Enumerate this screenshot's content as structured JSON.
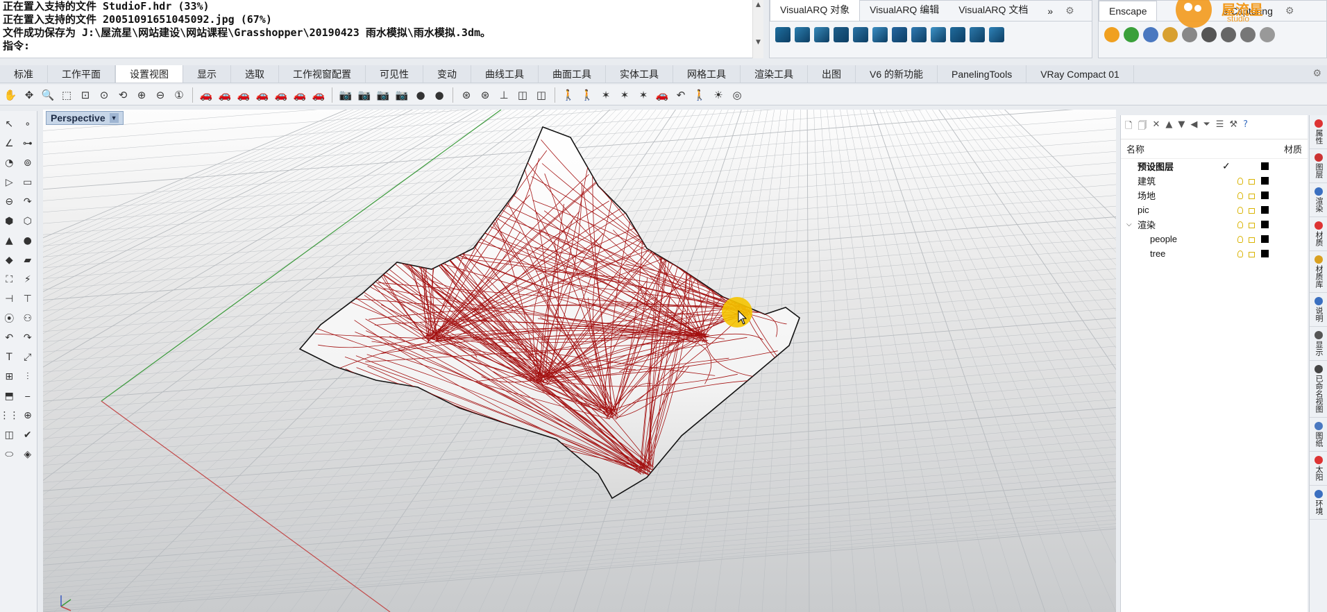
{
  "command_history": {
    "lines": [
      "正在置入支持的文件 StudioF.hdr (33%)",
      "正在置入支持的文件 20051091651045092.jpg (67%)",
      "文件成功保存为 J:\\屋流星\\网站建设\\网站课程\\Grasshopper\\20190423 雨水模拟\\雨水模拟.3dm。"
    ],
    "prompt_label": "指令:",
    "prompt_value": ""
  },
  "visualarq_panel": {
    "tabs": [
      "VisualARQ 对象",
      "VisualARQ 编辑",
      "VisualARQ 文档"
    ],
    "more": "»",
    "icon_colors": [
      "#1e6fa0",
      "#2c7fb0",
      "#3789b9",
      "#1f5f8b",
      "#2a73a6",
      "#3a8ec4",
      "#2566a0",
      "#2f7ab3",
      "#3d93c8",
      "#206b9d",
      "#2b78aa",
      "#2e82b8"
    ]
  },
  "enscape_panel": {
    "tabs": [
      "Enscape",
      "e Capturing"
    ],
    "icon_colors": [
      "#f0a020",
      "#3aa03a",
      "#4a78c0",
      "#d8a030",
      "#888",
      "#555",
      "#666",
      "#777",
      "#999"
    ]
  },
  "logo": {
    "text": "屋流星",
    "sub": "studio"
  },
  "main_tabs": [
    "标准",
    "工作平面",
    "设置视图",
    "显示",
    "选取",
    "工作视窗配置",
    "可见性",
    "变动",
    "曲线工具",
    "曲面工具",
    "实体工具",
    "网格工具",
    "渲染工具",
    "出图",
    "V6 的新功能",
    "PanelingTools",
    "VRay Compact 01"
  ],
  "active_tab": "设置视图",
  "toolbar_icons": [
    "pan-icon",
    "move-icon",
    "zoom-icon",
    "zoom-window-icon",
    "zoom-extents-icon",
    "zoom-selected-icon",
    "rotate-view-icon",
    "zoom-in-icon",
    "zoom-out-icon",
    "zoom-1to1-icon",
    "car-icon",
    "car-icon",
    "car-icon",
    "car-icon",
    "car-icon",
    "car-icon",
    "car-icon",
    "camera-icon",
    "camera-icon",
    "camera-icon",
    "camera-icon",
    "sphere-icon",
    "sphere-icon",
    "target-icon",
    "target-icon",
    "axis-icon",
    "cube-icon",
    "cube-icon",
    "walk-icon",
    "walk-icon",
    "star-icon",
    "star-icon",
    "star-icon",
    "car-icon",
    "undo-icon",
    "walk-icon",
    "sun-icon",
    "compass-icon"
  ],
  "viewport": {
    "title": "Perspective",
    "dropdown": "▼"
  },
  "layers": {
    "header_name": "名称",
    "header_material": "材质",
    "rows": [
      {
        "name": "预设图层",
        "current": true,
        "indent": 0
      },
      {
        "name": "建筑",
        "current": false,
        "indent": 0
      },
      {
        "name": "场地",
        "current": false,
        "indent": 0
      },
      {
        "name": "pic",
        "current": false,
        "indent": 0
      },
      {
        "name": "渲染",
        "current": false,
        "indent": 0,
        "expanded": true
      },
      {
        "name": "people",
        "current": false,
        "indent": 1
      },
      {
        "name": "tree",
        "current": false,
        "indent": 1
      }
    ]
  },
  "side_tabs": [
    {
      "label": "属性",
      "color": "#d33"
    },
    {
      "label": "图层",
      "color": "#c33"
    },
    {
      "label": "渲染",
      "color": "#3a6fc0"
    },
    {
      "label": "材质",
      "color": "#d33"
    },
    {
      "label": "材质库",
      "color": "#d9a020"
    },
    {
      "label": "说明",
      "color": "#3a6fc0"
    },
    {
      "label": "显示",
      "color": "#555"
    },
    {
      "label": "已命名视图",
      "color": "#444"
    },
    {
      "label": "图纸",
      "color": "#4a78c0"
    },
    {
      "label": "太阳",
      "color": "#d33"
    },
    {
      "label": "环境",
      "color": "#3a6fc0"
    }
  ],
  "colors": {
    "rain_red": "#a31010",
    "cursor_yellow": "#f5c400",
    "grid_line": "#b7bbbf"
  }
}
